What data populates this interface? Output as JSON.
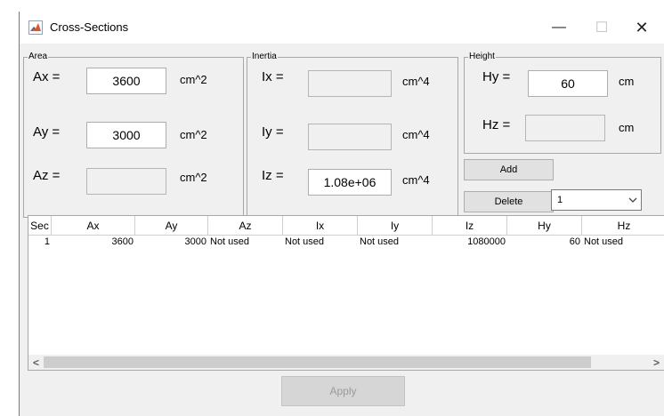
{
  "window": {
    "title": "Cross-Sections",
    "minimize": "—",
    "maximize": "☐",
    "close": "✕"
  },
  "area": {
    "legend": "Area",
    "ax": {
      "label": "Ax =",
      "value": "3600",
      "unit": "cm^2"
    },
    "ay": {
      "label": "Ay =",
      "value": "3000",
      "unit": "cm^2"
    },
    "az": {
      "label": "Az =",
      "value": "",
      "unit": "cm^2"
    }
  },
  "inertia": {
    "legend": "Inertia",
    "ix": {
      "label": "Ix =",
      "value": "",
      "unit": "cm^4"
    },
    "iy": {
      "label": "Iy =",
      "value": "",
      "unit": "cm^4"
    },
    "iz": {
      "label": "Iz =",
      "value": "1.08e+06",
      "unit": "cm^4"
    }
  },
  "height": {
    "legend": "Height",
    "hy": {
      "label": "Hy =",
      "value": "60",
      "unit": "cm"
    },
    "hz": {
      "label": "Hz =",
      "value": "",
      "unit": "cm"
    }
  },
  "actions": {
    "add": "Add",
    "delete": "Delete",
    "section_select": "1",
    "apply": "Apply"
  },
  "table": {
    "columns": [
      "Sec",
      "Ax",
      "Ay",
      "Az",
      "Ix",
      "Iy",
      "Iz",
      "Hy",
      "Hz"
    ],
    "rows": [
      [
        "1",
        "3600",
        "3000",
        "Not used",
        "Not used",
        "Not used",
        "1080000",
        "60",
        "Not used"
      ]
    ]
  },
  "scrollbar": {
    "left": "<",
    "right": ">"
  }
}
